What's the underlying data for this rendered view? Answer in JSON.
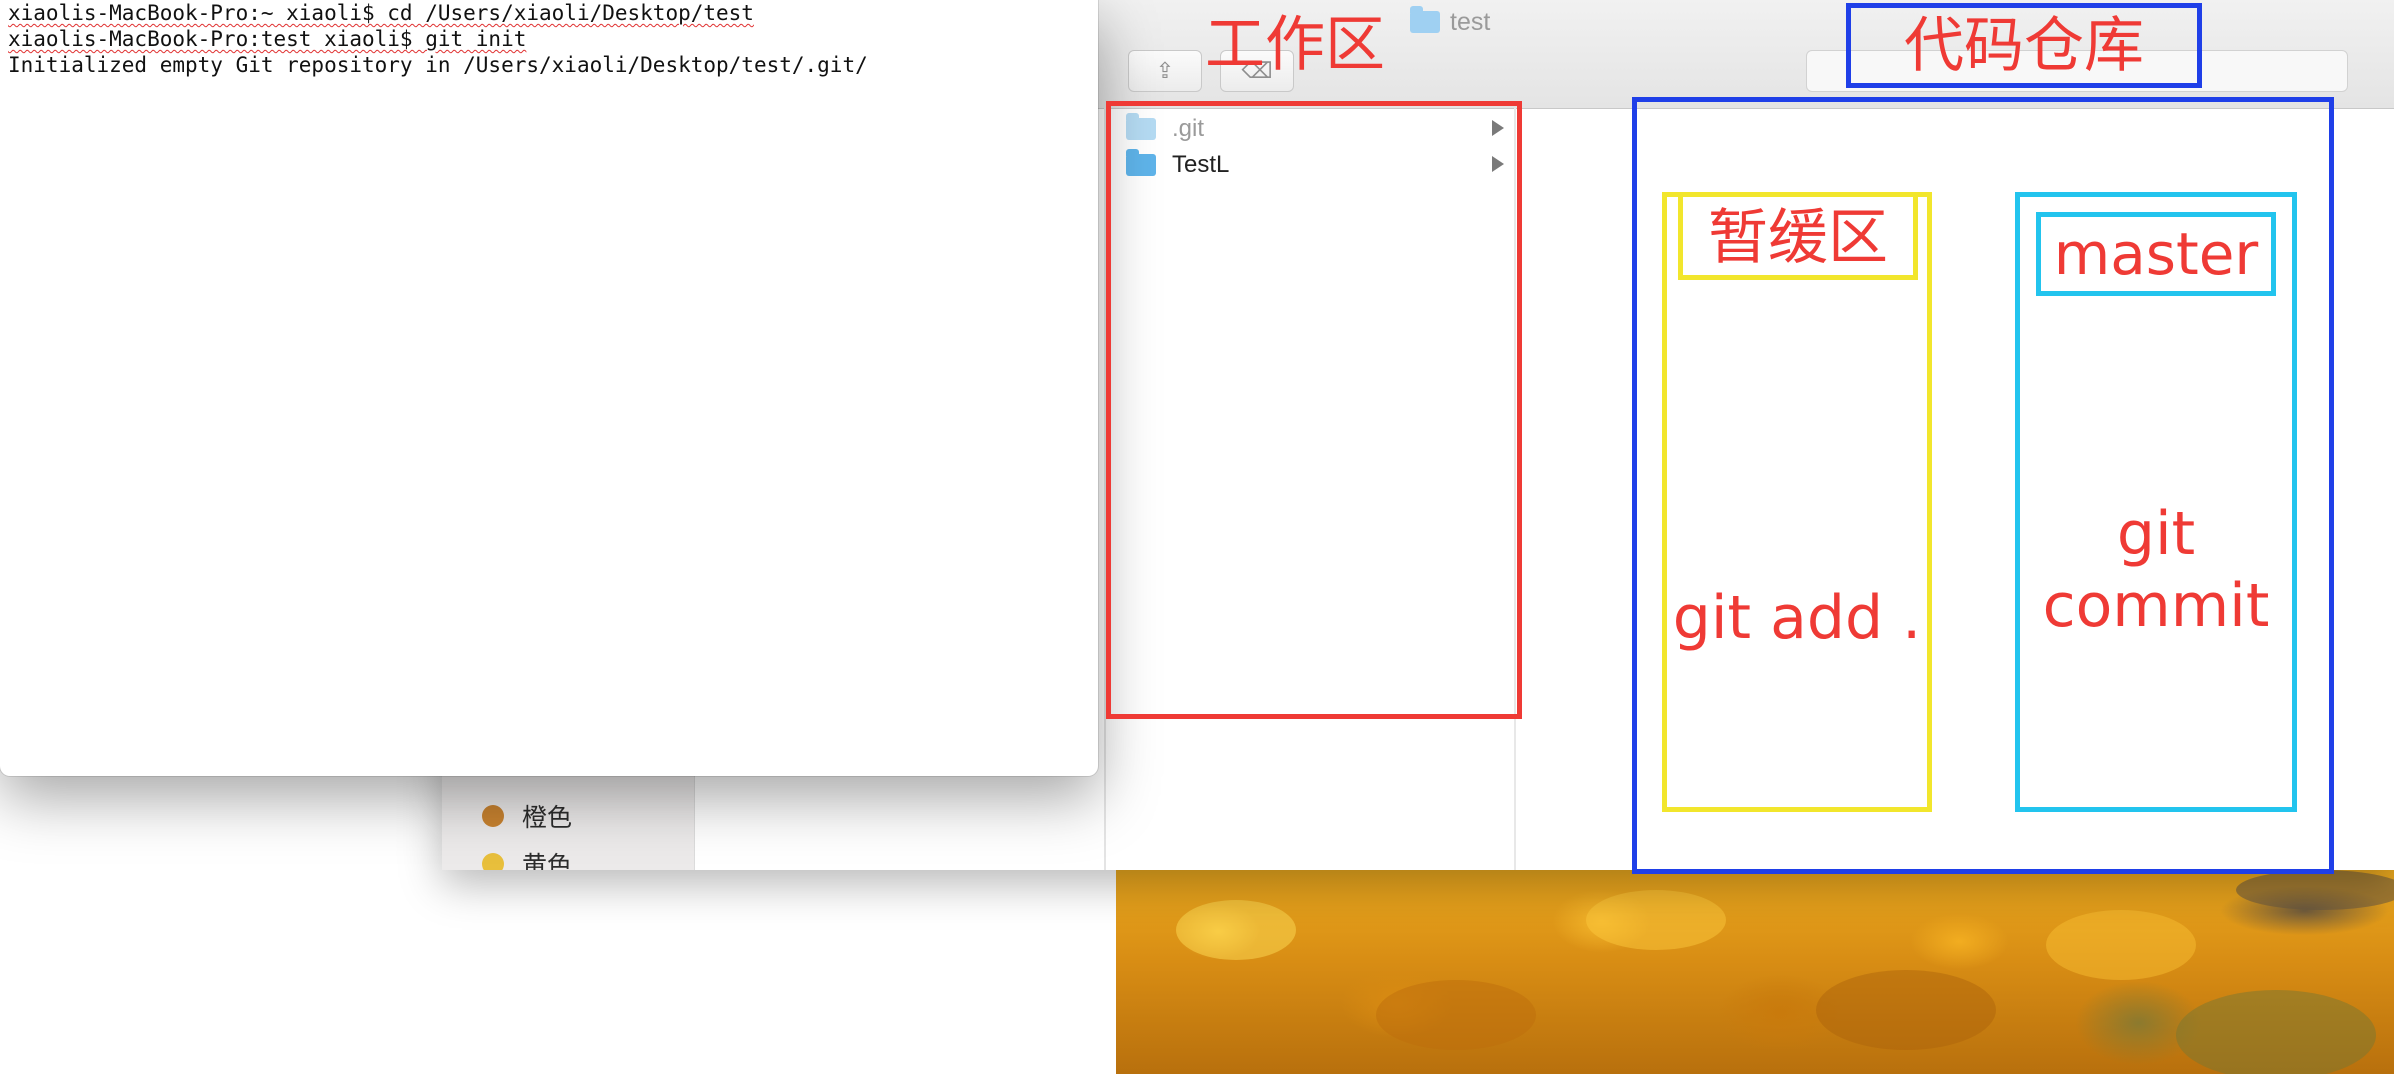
{
  "terminal": {
    "lines": [
      "xiaolis-MacBook-Pro:~ xiaoli$ cd /Users/xiaoli/Desktop/test",
      "xiaolis-MacBook-Pro:test xiaoli$ git init",
      "Initialized empty Git repository in /Users/xiaoli/Desktop/test/.git/"
    ]
  },
  "finder": {
    "window_title": "test",
    "files": [
      {
        "name": ".git",
        "icon": "folder-icon"
      },
      {
        "name": "TestL",
        "icon": "folder-icon"
      }
    ],
    "sidebar_tags": [
      {
        "label": "橙色",
        "color": "#c98330"
      },
      {
        "label": "黄色",
        "color": "#e8bf3c"
      }
    ]
  },
  "annotations": {
    "workspace_label": "工作区",
    "repository_label": "代码仓库",
    "staging_label": "暂缓区",
    "staging_command": "git add .",
    "branch_label": "master",
    "branch_command_line1": "git",
    "branch_command_line2": "commit"
  },
  "colors": {
    "red": "#ef3a35",
    "blue": "#1f3fe8",
    "yellow": "#f2e62c",
    "cyan": "#22c4ee"
  }
}
